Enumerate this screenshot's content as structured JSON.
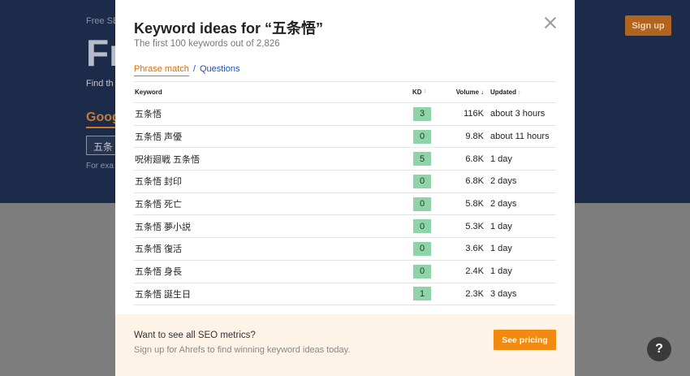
{
  "background": {
    "free_label": "Free SE",
    "hero_big": "Fr",
    "find_text": "Find th",
    "google_tab": "Goog",
    "input_value": "五条",
    "example_text": "For exa",
    "signup_label": "Sign up",
    "help_label": "?"
  },
  "modal": {
    "title": "Keyword ideas for “五条悟”",
    "subtitle": "The first 100 keywords out of 2,826",
    "tabs": {
      "phrase_match": "Phrase match",
      "separator": "/",
      "questions": "Questions"
    },
    "table": {
      "headers": {
        "keyword": "Keyword",
        "kd": "KD",
        "volume": "Volume",
        "updated": "Updated"
      },
      "rows": [
        {
          "keyword": "五条悟",
          "kd": "3",
          "volume": "116K",
          "updated": "about 3 hours"
        },
        {
          "keyword": "五条悟 声優",
          "kd": "0",
          "volume": "9.8K",
          "updated": "about 11 hours"
        },
        {
          "keyword": "呪術廻戦 五条悟",
          "kd": "5",
          "volume": "6.8K",
          "updated": "1 day"
        },
        {
          "keyword": "五条悟 封印",
          "kd": "0",
          "volume": "6.8K",
          "updated": "2 days"
        },
        {
          "keyword": "五条悟 死亡",
          "kd": "0",
          "volume": "5.8K",
          "updated": "2 days"
        },
        {
          "keyword": "五条悟 夢小説",
          "kd": "0",
          "volume": "5.3K",
          "updated": "1 day"
        },
        {
          "keyword": "五条悟 復活",
          "kd": "0",
          "volume": "3.6K",
          "updated": "1 day"
        },
        {
          "keyword": "五条悟 身長",
          "kd": "0",
          "volume": "2.4K",
          "updated": "1 day"
        },
        {
          "keyword": "五条悟 誕生日",
          "kd": "1",
          "volume": "2.3K",
          "updated": "3 days"
        }
      ]
    },
    "footer": {
      "title": "Want to see all SEO metrics?",
      "subtitle": "Sign up for Ahrefs to find winning keyword ideas today.",
      "pricing_label": "See pricing"
    }
  },
  "colors": {
    "accent": "#f28a10",
    "kd_badge": "#8fd4a8",
    "link": "#1d4fc4"
  }
}
